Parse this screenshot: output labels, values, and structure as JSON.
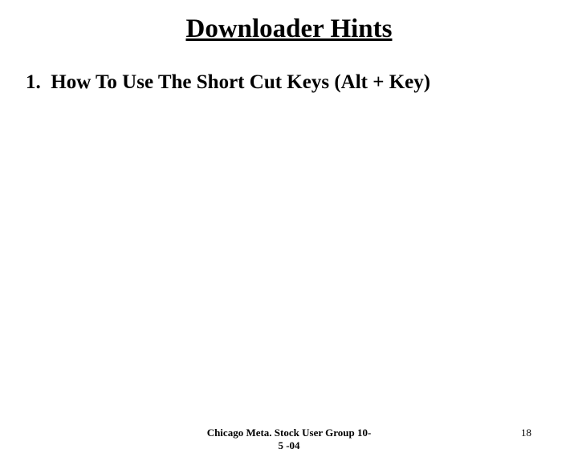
{
  "title": "Downloader Hints",
  "items": [
    {
      "number": "1.",
      "text": "How To Use The Short Cut Keys (Alt + Key)"
    }
  ],
  "footer": {
    "center_line1": "Chicago Meta. Stock User Group 10-",
    "center_line2": "5 -04",
    "page_number": "18"
  }
}
